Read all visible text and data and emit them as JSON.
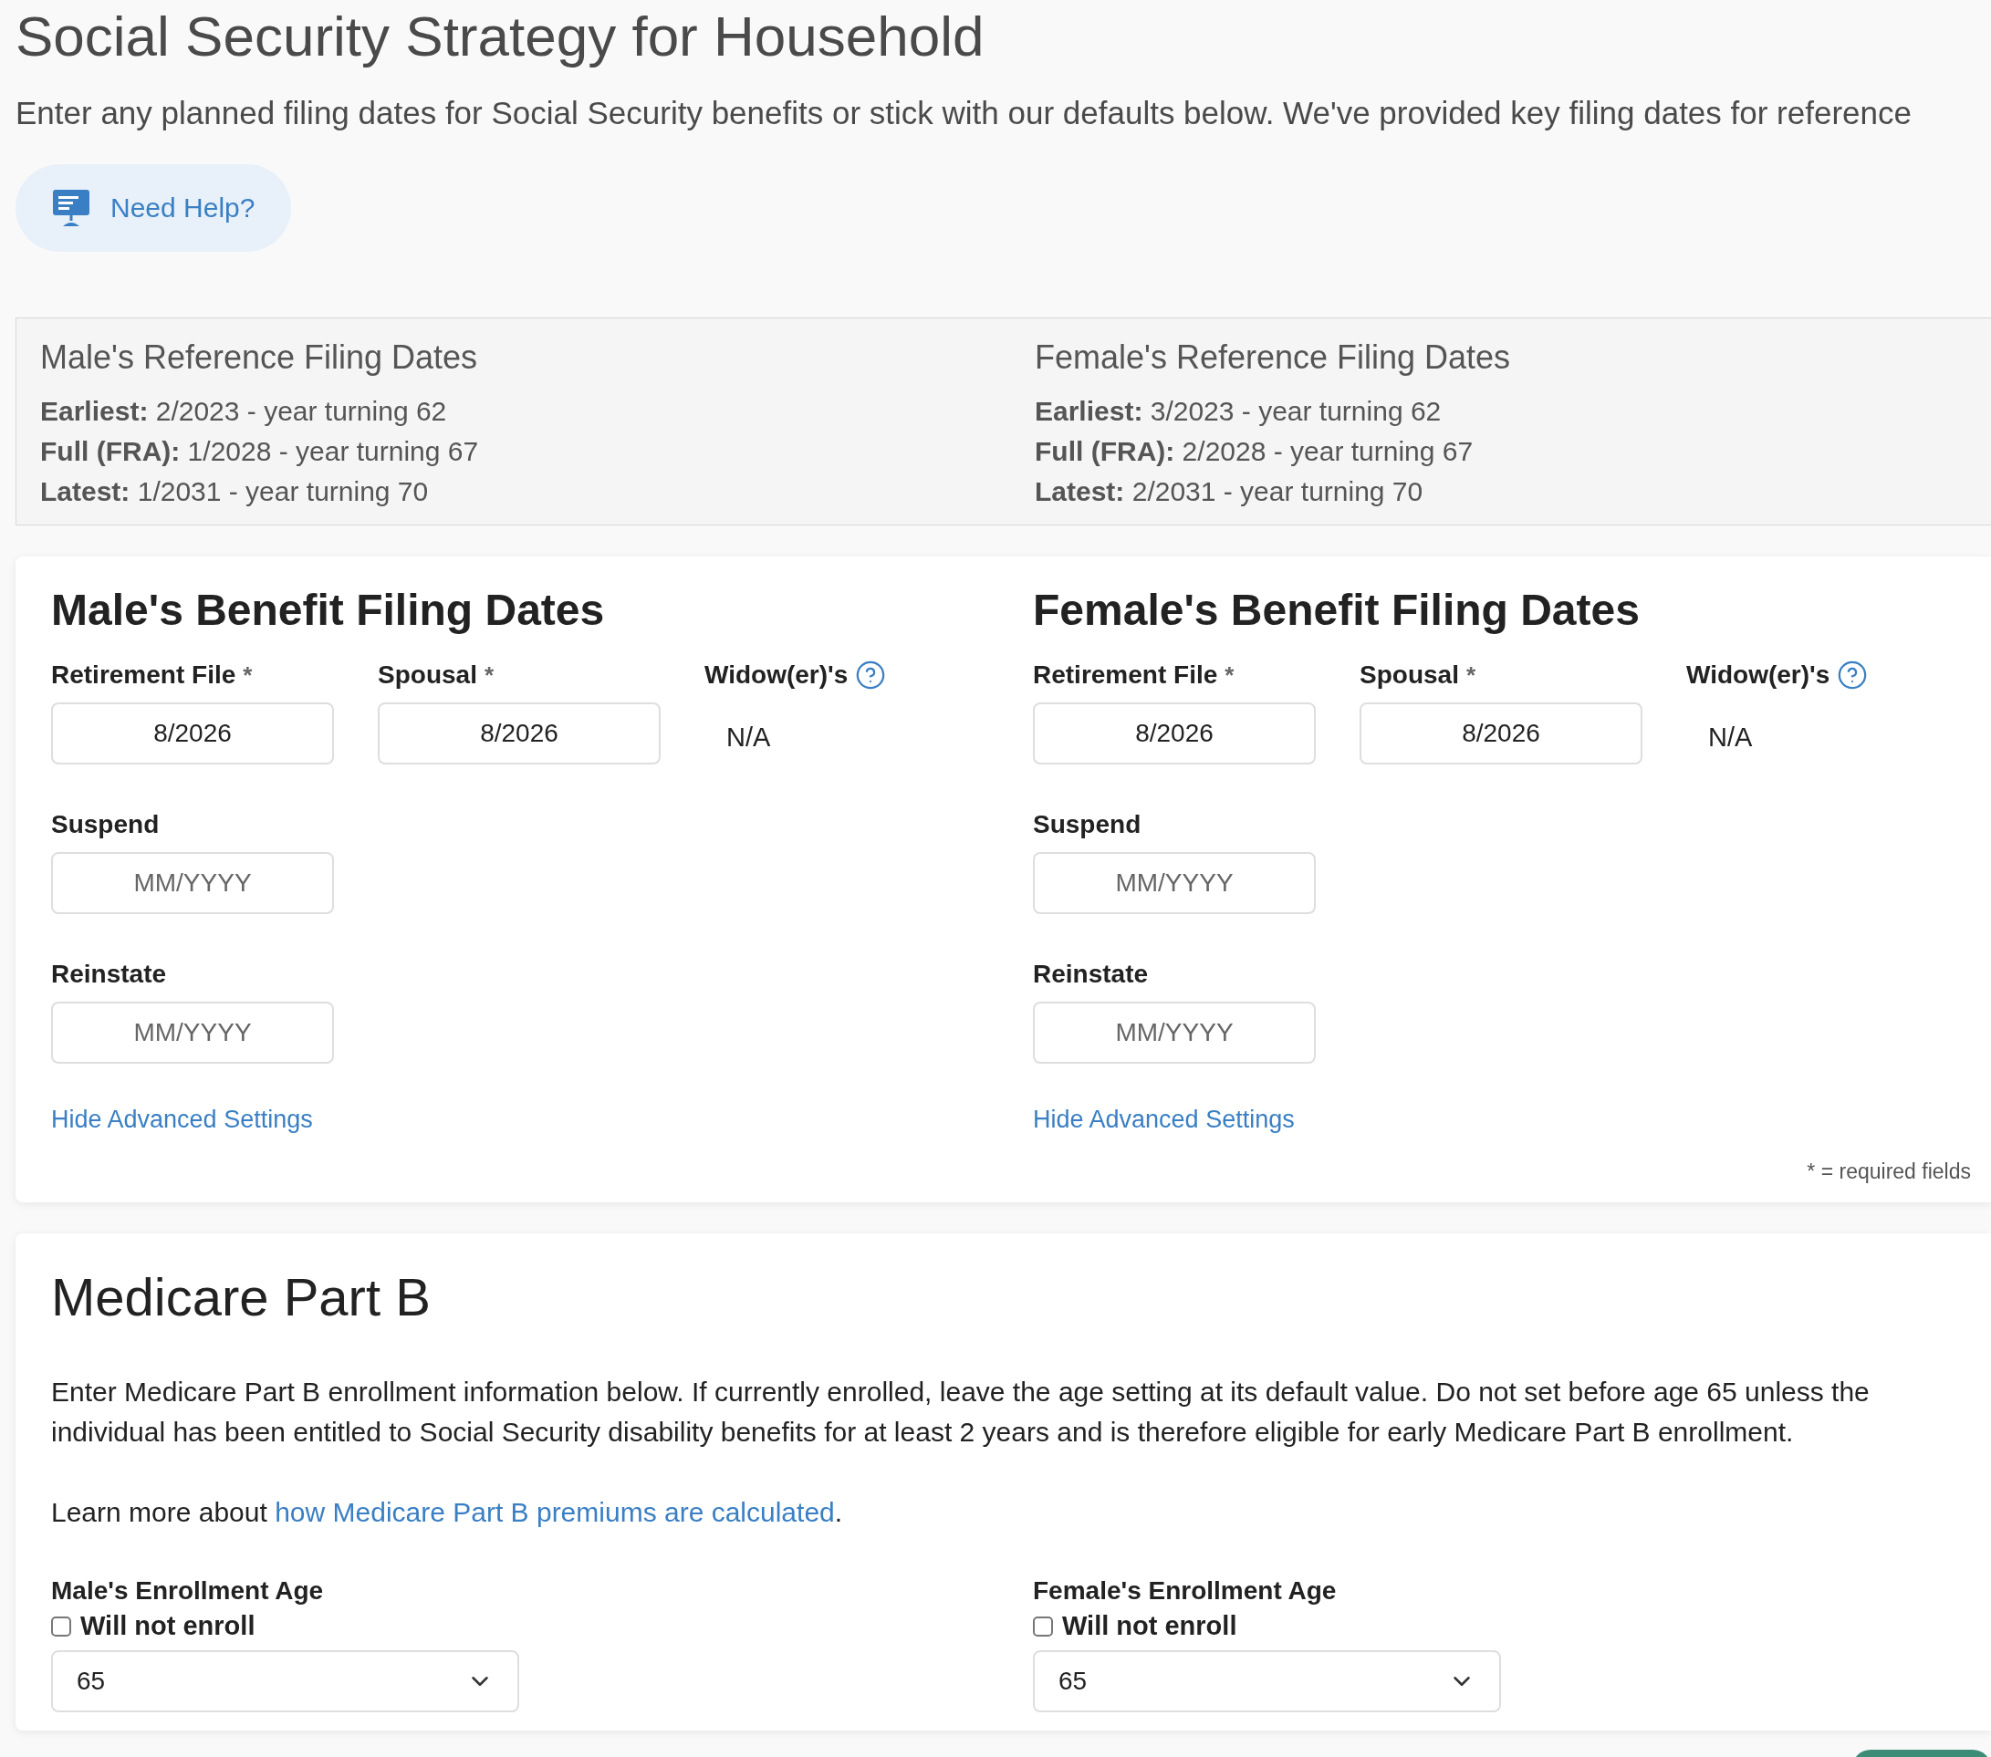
{
  "title": "Social Security Strategy for Household",
  "subtitle": "Enter any planned filing dates for Social Security benefits or stick with our defaults below. We've provided key filing dates for reference",
  "help_button": {
    "label": "Need Help?"
  },
  "reference_dates": [
    {
      "title": "Male's Reference Filing Dates",
      "lines": [
        "**Earliest:** 2/2023 - year turning 62",
        "**Full (FRA):** 1/2028 - year turning 67",
        "**Latest:** 1/2031 - year turning 70"
      ]
    },
    {
      "title": "Female's Reference Filing Dates",
      "lines": [
        "**Earliest:** 3/2023 - year turning 62",
        "**Full (FRA):** 2/2028 - year turning 67",
        "**Latest:** 2/2031 - year turning 70"
      ]
    }
  ],
  "filing_dates": {
    "columns": [
      {
        "heading": "Male's Benefit Filing Dates",
        "top_fields": [
          {
            "kind": "input",
            "label": "Retirement File",
            "required_mark": "*",
            "value": "8/2026"
          },
          {
            "kind": "input",
            "label": "Spousal",
            "required_mark": "*",
            "value": "8/2026"
          },
          {
            "kind": "readonly",
            "label": "Widow(er)'s",
            "value": "N/A"
          }
        ],
        "advanced_fields": [
          {
            "label": "Suspend",
            "placeholder": "MM/YYYY"
          },
          {
            "label": "Reinstate",
            "placeholder": "MM/YYYY"
          }
        ],
        "toggle_link": "Hide Advanced Settings"
      },
      {
        "heading": "Female's Benefit Filing Dates",
        "top_fields": [
          {
            "kind": "input",
            "label": "Retirement File",
            "required_mark": "*",
            "value": "8/2026"
          },
          {
            "kind": "input",
            "label": "Spousal",
            "required_mark": "*",
            "value": "8/2026"
          },
          {
            "kind": "readonly",
            "label": "Widow(er)'s",
            "value": "N/A"
          }
        ],
        "advanced_fields": [
          {
            "label": "Suspend",
            "placeholder": "MM/YYYY"
          },
          {
            "label": "Reinstate",
            "placeholder": "MM/YYYY"
          }
        ],
        "toggle_link": "Hide Advanced Settings"
      }
    ],
    "required_note": "* = required fields"
  },
  "medicare": {
    "heading": "Medicare Part B",
    "description": "Enter Medicare Part B enrollment information below. If currently enrolled, leave the age setting at its default value. Do not set before age 65 unless the individual has been entitled to Social Security disability benefits for at least 2 years and is therefore eligible for early Medicare Part B enrollment.",
    "learn_more": {
      "prefix": "Learn more about ",
      "link": "how Medicare Part B premiums are calculated",
      "suffix": "."
    },
    "enrollment": [
      {
        "label": "Male's Enrollment Age",
        "checkbox_label": "Will not enroll",
        "checked": false,
        "value": "65"
      },
      {
        "label": "Female's Enrollment Age",
        "checkbox_label": "Will not enroll",
        "checked": false,
        "value": "65"
      }
    ]
  }
}
